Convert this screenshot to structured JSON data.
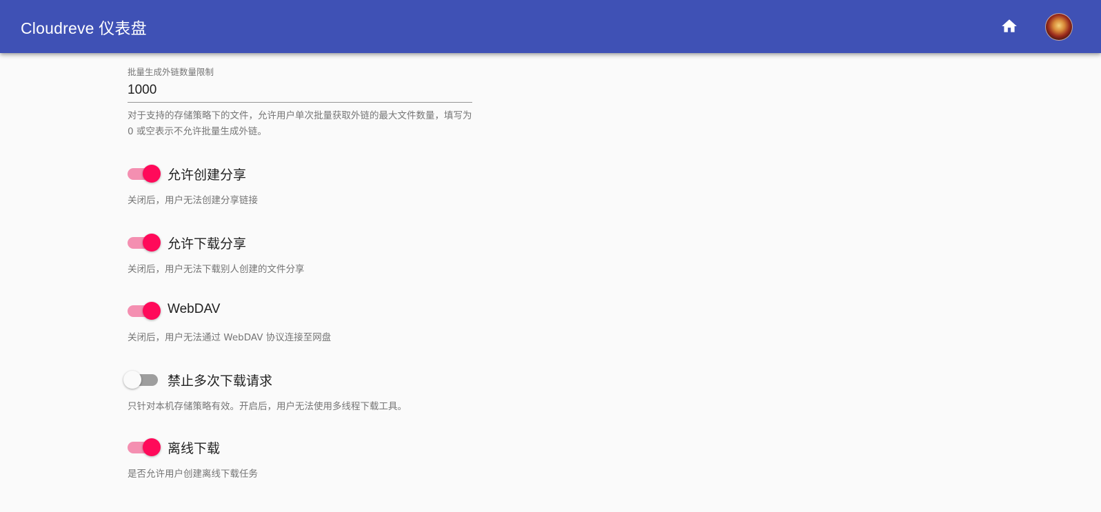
{
  "appbar": {
    "title": "Cloudreve 仪表盘",
    "icons": [
      "home-icon",
      "user-avatar"
    ]
  },
  "form": {
    "batch_link_limit": {
      "label": "批量生成外链数量限制",
      "value": "1000",
      "help": "对于支持的存储策略下的文件，允许用户单次批量获取外链的最大文件数量，填写为 0 或空表示不允许批量生成外链。"
    },
    "settings": [
      {
        "label": "允许创建分享",
        "help": "关闭后，用户无法创建分享链接",
        "checked": true
      },
      {
        "label": "允许下载分享",
        "help": "关闭后，用户无法下载别人创建的文件分享",
        "checked": true
      },
      {
        "label": "WebDAV",
        "help": "关闭后，用户无法通过 WebDAV 协议连接至网盘",
        "checked": true
      },
      {
        "label": "禁止多次下载请求",
        "help": "只针对本机存储策略有效。开启后，用户无法使用多线程下载工具。",
        "checked": false
      },
      {
        "label": "离线下载",
        "help": "是否允许用户创建离线下载任务",
        "checked": true
      }
    ]
  },
  "colors": {
    "appbar": "#3f51b5",
    "switch_on": "#ff0a5a",
    "switch_track_on": "#f48fb1",
    "switch_off_track": "#9e9e9e"
  }
}
